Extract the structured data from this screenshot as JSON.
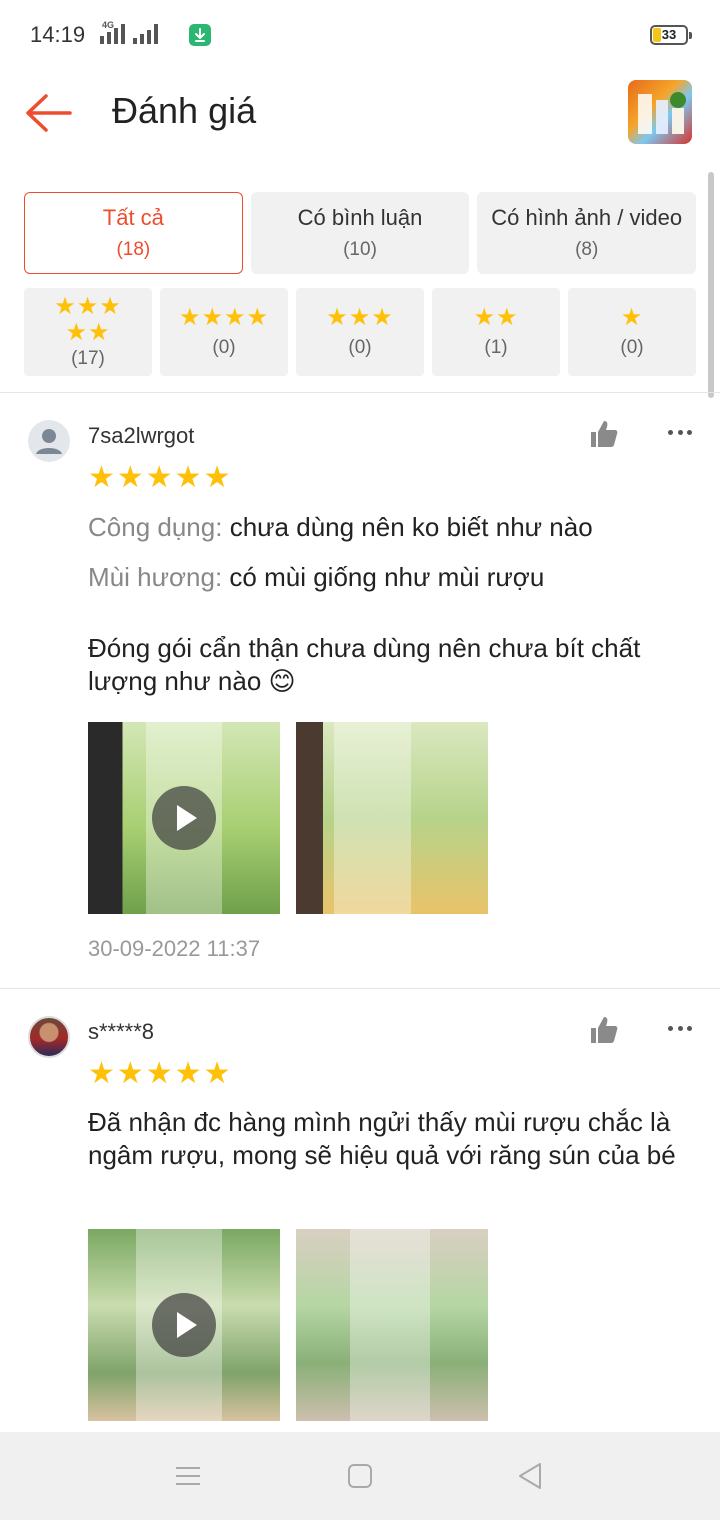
{
  "status_bar": {
    "time": "14:19",
    "network": "4G",
    "battery": "33"
  },
  "header": {
    "title": "Đánh giá",
    "back_icon": "arrow-left-icon",
    "accent_color": "#ee4d2d"
  },
  "filters": [
    {
      "label": "Tất cả",
      "count": "(18)",
      "active": true
    },
    {
      "label": "Có bình luận",
      "count": "(10)",
      "active": false
    },
    {
      "label": "Có hình ảnh / video",
      "count": "(8)",
      "active": false
    }
  ],
  "star_filters": [
    {
      "stars": "★★★\n★★",
      "count": "(17)"
    },
    {
      "stars": "★★★★",
      "count": "(0)"
    },
    {
      "stars": "★★★",
      "count": "(0)"
    },
    {
      "stars": "★★",
      "count": "(1)"
    },
    {
      "stars": "★",
      "count": "(0)"
    }
  ],
  "reviews": [
    {
      "username": "7sa2lwrgot",
      "rating": 5,
      "stars": "★★★★★",
      "attributes": [
        {
          "key": "Công dụng:",
          "value": "chưa dùng nên ko biết như nào"
        },
        {
          "key": "Mùi hương:",
          "value": "có mùi giống như mùi rượu"
        }
      ],
      "text": "Đóng gói cẩn thận chưa dùng nên chưa bít chất lượng như nào 😊",
      "media": [
        "video",
        "image"
      ],
      "time": "30-09-2022 11:37"
    },
    {
      "username": "s*****8",
      "rating": 5,
      "stars": "★★★★★",
      "text": "Đã nhận đc hàng mình ngửi thấy mùi rượu chắc là ngâm rượu, mong sẽ hiệu quả với răng sún của bé",
      "media": [
        "video",
        "image"
      ]
    }
  ],
  "nav": {
    "menu_icon": "menu-icon",
    "home_icon": "square-home-icon",
    "back_icon": "triangle-back-icon"
  }
}
